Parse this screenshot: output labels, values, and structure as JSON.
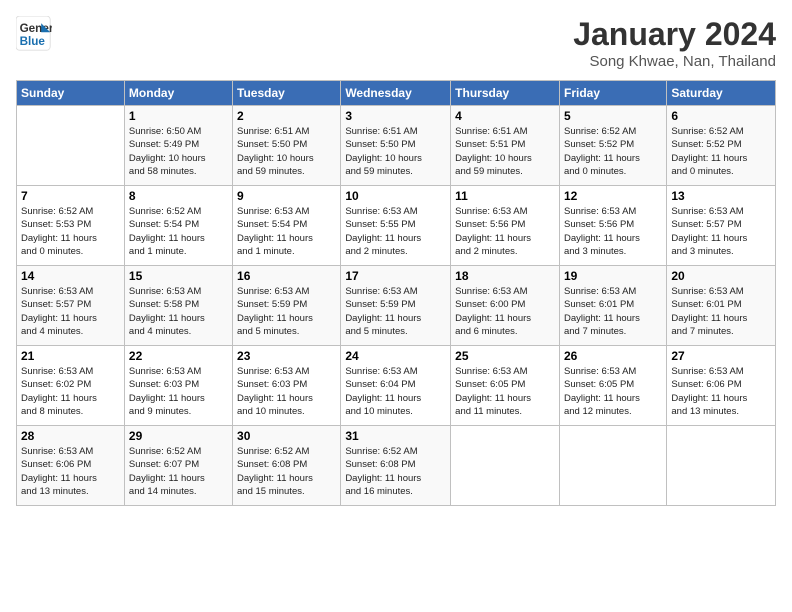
{
  "header": {
    "logo": {
      "line1": "General",
      "line2": "Blue"
    },
    "title": "January 2024",
    "location": "Song Khwae, Nan, Thailand"
  },
  "days_of_week": [
    "Sunday",
    "Monday",
    "Tuesday",
    "Wednesday",
    "Thursday",
    "Friday",
    "Saturday"
  ],
  "weeks": [
    [
      {
        "day": "",
        "info": ""
      },
      {
        "day": "1",
        "info": "Sunrise: 6:50 AM\nSunset: 5:49 PM\nDaylight: 10 hours\nand 58 minutes."
      },
      {
        "day": "2",
        "info": "Sunrise: 6:51 AM\nSunset: 5:50 PM\nDaylight: 10 hours\nand 59 minutes."
      },
      {
        "day": "3",
        "info": "Sunrise: 6:51 AM\nSunset: 5:50 PM\nDaylight: 10 hours\nand 59 minutes."
      },
      {
        "day": "4",
        "info": "Sunrise: 6:51 AM\nSunset: 5:51 PM\nDaylight: 10 hours\nand 59 minutes."
      },
      {
        "day": "5",
        "info": "Sunrise: 6:52 AM\nSunset: 5:52 PM\nDaylight: 11 hours\nand 0 minutes."
      },
      {
        "day": "6",
        "info": "Sunrise: 6:52 AM\nSunset: 5:52 PM\nDaylight: 11 hours\nand 0 minutes."
      }
    ],
    [
      {
        "day": "7",
        "info": "Sunrise: 6:52 AM\nSunset: 5:53 PM\nDaylight: 11 hours\nand 0 minutes."
      },
      {
        "day": "8",
        "info": "Sunrise: 6:52 AM\nSunset: 5:54 PM\nDaylight: 11 hours\nand 1 minute."
      },
      {
        "day": "9",
        "info": "Sunrise: 6:53 AM\nSunset: 5:54 PM\nDaylight: 11 hours\nand 1 minute."
      },
      {
        "day": "10",
        "info": "Sunrise: 6:53 AM\nSunset: 5:55 PM\nDaylight: 11 hours\nand 2 minutes."
      },
      {
        "day": "11",
        "info": "Sunrise: 6:53 AM\nSunset: 5:56 PM\nDaylight: 11 hours\nand 2 minutes."
      },
      {
        "day": "12",
        "info": "Sunrise: 6:53 AM\nSunset: 5:56 PM\nDaylight: 11 hours\nand 3 minutes."
      },
      {
        "day": "13",
        "info": "Sunrise: 6:53 AM\nSunset: 5:57 PM\nDaylight: 11 hours\nand 3 minutes."
      }
    ],
    [
      {
        "day": "14",
        "info": "Sunrise: 6:53 AM\nSunset: 5:57 PM\nDaylight: 11 hours\nand 4 minutes."
      },
      {
        "day": "15",
        "info": "Sunrise: 6:53 AM\nSunset: 5:58 PM\nDaylight: 11 hours\nand 4 minutes."
      },
      {
        "day": "16",
        "info": "Sunrise: 6:53 AM\nSunset: 5:59 PM\nDaylight: 11 hours\nand 5 minutes."
      },
      {
        "day": "17",
        "info": "Sunrise: 6:53 AM\nSunset: 5:59 PM\nDaylight: 11 hours\nand 5 minutes."
      },
      {
        "day": "18",
        "info": "Sunrise: 6:53 AM\nSunset: 6:00 PM\nDaylight: 11 hours\nand 6 minutes."
      },
      {
        "day": "19",
        "info": "Sunrise: 6:53 AM\nSunset: 6:01 PM\nDaylight: 11 hours\nand 7 minutes."
      },
      {
        "day": "20",
        "info": "Sunrise: 6:53 AM\nSunset: 6:01 PM\nDaylight: 11 hours\nand 7 minutes."
      }
    ],
    [
      {
        "day": "21",
        "info": "Sunrise: 6:53 AM\nSunset: 6:02 PM\nDaylight: 11 hours\nand 8 minutes."
      },
      {
        "day": "22",
        "info": "Sunrise: 6:53 AM\nSunset: 6:03 PM\nDaylight: 11 hours\nand 9 minutes."
      },
      {
        "day": "23",
        "info": "Sunrise: 6:53 AM\nSunset: 6:03 PM\nDaylight: 11 hours\nand 10 minutes."
      },
      {
        "day": "24",
        "info": "Sunrise: 6:53 AM\nSunset: 6:04 PM\nDaylight: 11 hours\nand 10 minutes."
      },
      {
        "day": "25",
        "info": "Sunrise: 6:53 AM\nSunset: 6:05 PM\nDaylight: 11 hours\nand 11 minutes."
      },
      {
        "day": "26",
        "info": "Sunrise: 6:53 AM\nSunset: 6:05 PM\nDaylight: 11 hours\nand 12 minutes."
      },
      {
        "day": "27",
        "info": "Sunrise: 6:53 AM\nSunset: 6:06 PM\nDaylight: 11 hours\nand 13 minutes."
      }
    ],
    [
      {
        "day": "28",
        "info": "Sunrise: 6:53 AM\nSunset: 6:06 PM\nDaylight: 11 hours\nand 13 minutes."
      },
      {
        "day": "29",
        "info": "Sunrise: 6:52 AM\nSunset: 6:07 PM\nDaylight: 11 hours\nand 14 minutes."
      },
      {
        "day": "30",
        "info": "Sunrise: 6:52 AM\nSunset: 6:08 PM\nDaylight: 11 hours\nand 15 minutes."
      },
      {
        "day": "31",
        "info": "Sunrise: 6:52 AM\nSunset: 6:08 PM\nDaylight: 11 hours\nand 16 minutes."
      },
      {
        "day": "",
        "info": ""
      },
      {
        "day": "",
        "info": ""
      },
      {
        "day": "",
        "info": ""
      }
    ]
  ]
}
